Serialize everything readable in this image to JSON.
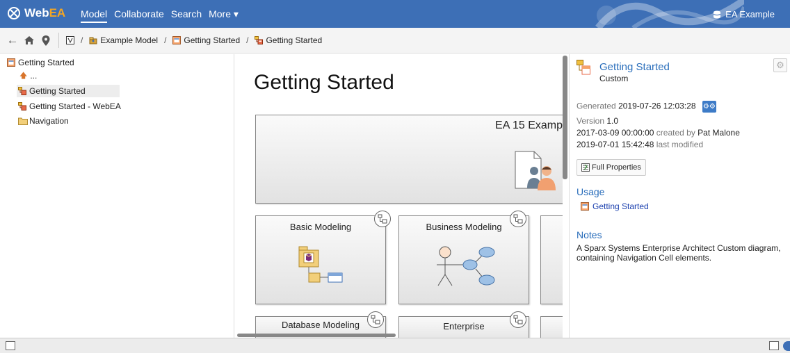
{
  "app": {
    "logo": {
      "web": "Web",
      "ea": "EA"
    },
    "nav": [
      "Model",
      "Collaborate",
      "Search",
      "More ▾"
    ],
    "model_name": "EA Example"
  },
  "breadcrumb": [
    {
      "label": "",
      "icon": "model-root-icon"
    },
    {
      "label": "Example Model",
      "icon": "package-icon"
    },
    {
      "label": "Getting Started",
      "icon": "diagram-icon"
    },
    {
      "label": "Getting Started",
      "icon": "custom-diagram-icon"
    }
  ],
  "tree": {
    "root": "Getting Started",
    "up": "...",
    "items": [
      {
        "label": "Getting Started",
        "icon": "custom-diagram-icon",
        "selected": true
      },
      {
        "label": "Getting Started - WebEA",
        "icon": "custom-diagram-icon",
        "selected": false
      },
      {
        "label": "Navigation",
        "icon": "folder-icon",
        "selected": false
      }
    ]
  },
  "diagram": {
    "title": "Getting Started",
    "cells": {
      "ea15": "EA 15 Examp",
      "basic": "Basic Modeling",
      "business": "Business Modeling",
      "database": "Database Modeling",
      "enterprise": "Enterprise"
    }
  },
  "props": {
    "title": "Getting Started",
    "subtitle": "Custom",
    "generated_label": "Generated",
    "generated_value": "2019-07-26 12:03:28",
    "version_label": "Version",
    "version_value": "1.0",
    "created_date": "2017-03-09 00:00:00",
    "created_by_label": "created by",
    "created_by": "Pat Malone",
    "modified_date": "2019-07-01 15:42:48",
    "modified_label": "last modified",
    "full_properties": "Full Properties",
    "usage_heading": "Usage",
    "usage_link": "Getting Started",
    "notes_heading": "Notes",
    "notes_text": "A Sparx Systems Enterprise Architect Custom diagram, containing Navigation Cell elements."
  },
  "colors": {
    "brand": "#3d6fb6",
    "accent": "#f5a623",
    "link": "#2a6ebb"
  }
}
